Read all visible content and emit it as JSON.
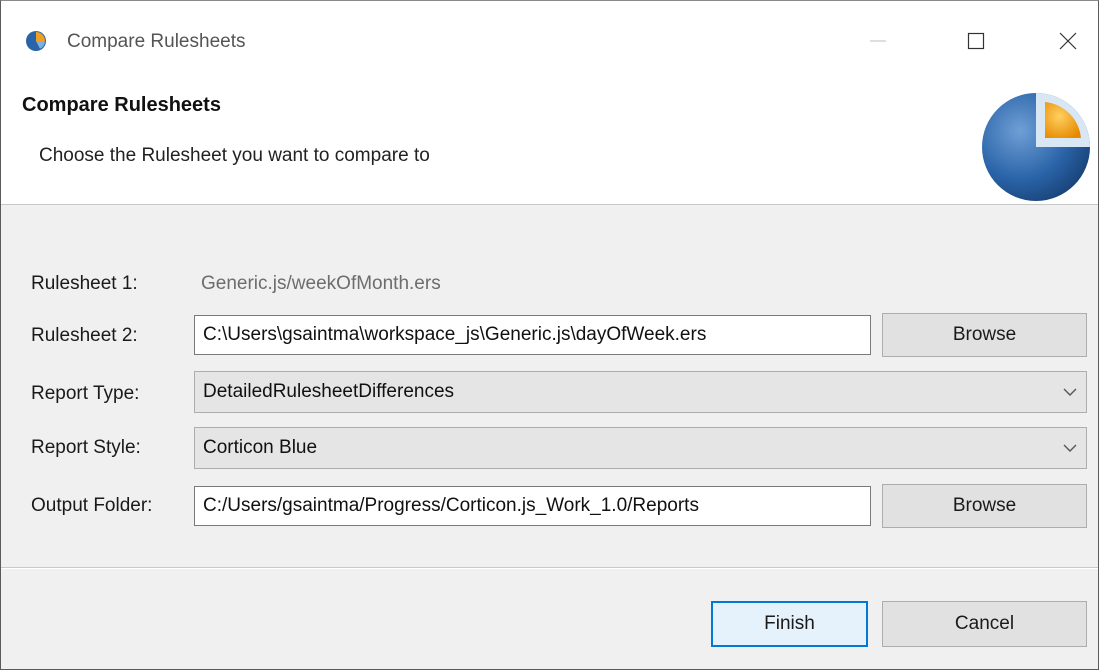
{
  "window": {
    "title": "Compare Rulesheets",
    "controls": {
      "minimize": "minimize",
      "maximize": "maximize",
      "close": "close"
    }
  },
  "header": {
    "title": "Compare Rulesheets",
    "description": "Choose the Rulesheet you want to compare to",
    "logo_icon": "corticon-logo"
  },
  "form": {
    "rulesheet1": {
      "label": "Rulesheet 1:",
      "value": "Generic.js/weekOfMonth.ers"
    },
    "rulesheet2": {
      "label": "Rulesheet 2:",
      "value": "C:\\Users\\gsaintma\\workspace_js\\Generic.js\\dayOfWeek.ers",
      "button": "Browse"
    },
    "report_type": {
      "label": "Report Type:",
      "selected": "DetailedRulesheetDifferences"
    },
    "report_style": {
      "label": "Report Style:",
      "selected": "Corticon Blue"
    },
    "output_folder": {
      "label": "Output Folder:",
      "value": "C:/Users/gsaintma/Progress/Corticon.js_Work_1.0/Reports",
      "button": "Browse"
    }
  },
  "footer": {
    "finish_label": "Finish",
    "cancel_label": "Cancel"
  },
  "colors": {
    "accent": "#0078d7",
    "logo_blue": "#2a64a8",
    "logo_orange": "#f0a020"
  }
}
